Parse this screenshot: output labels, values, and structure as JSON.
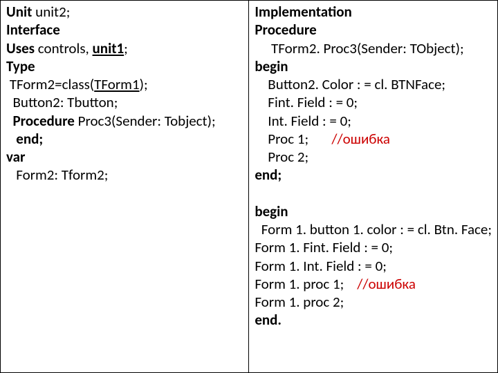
{
  "left": {
    "l1a": "Unit",
    "l1b": " unit2;",
    "l2": "Interface",
    "l3a": "Uses",
    "l3b": " controls, ",
    "l3c": "unit1",
    "l3d": ";",
    "l4": "Type",
    "l5a": " TForm2=class(",
    "l5b": "TForm1",
    "l5c": ");",
    "l6": "  Button2: Tbutton;",
    "l7a": "  Procedure",
    "l7b": " Proc3(Sender: Tobject);",
    "l8": "   end;",
    "l9": "var",
    "l10": "   Form2: Tform2;"
  },
  "right": {
    "r1": "Implementation",
    "r2": "Procedure",
    "r3": "     TForm2. Proc3(Sender: TObject);",
    "r4": "begin",
    "r5": "    Button2. Color : = cl. BTNFace;",
    "r6": "    Fint. Field : = 0;",
    "r7": "    Int. Field : = 0;",
    "r8a": "    Proc 1;       ",
    "r8b": "//ошибка",
    "r9": "    Proc 2;",
    "r10": "end;",
    "r11": "",
    "r12": "begin",
    "r13": "  Form 1. button 1. color : = cl. Btn. Face;",
    "r14": "Form 1. Fint. Field : = 0;",
    "r15": "Form 1. Int. Field : = 0;",
    "r16a": "Form 1. proc 1;    ",
    "r16b": "//ошибка",
    "r17": "Form 1. proc 2;",
    "r18": "end."
  }
}
